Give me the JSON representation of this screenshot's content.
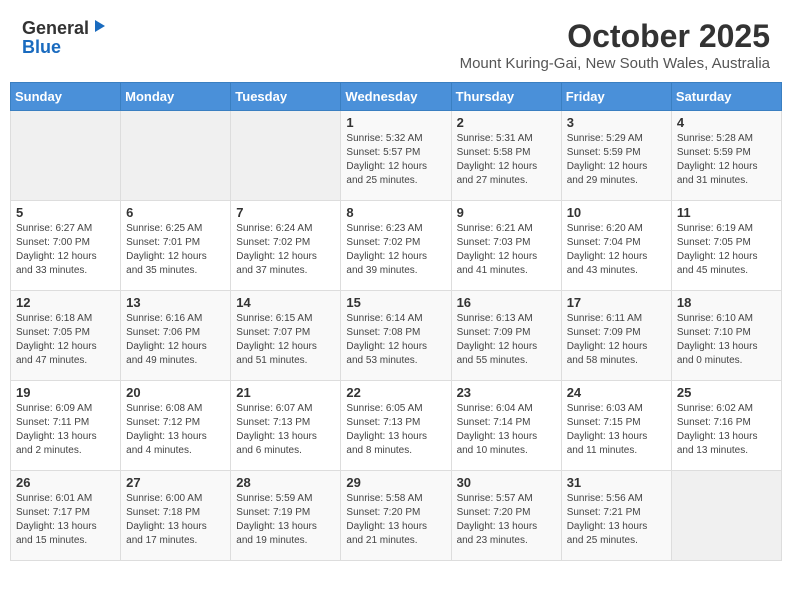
{
  "logo": {
    "general": "General",
    "blue": "Blue"
  },
  "title": "October 2025",
  "location": "Mount Kuring-Gai, New South Wales, Australia",
  "days_header": [
    "Sunday",
    "Monday",
    "Tuesday",
    "Wednesday",
    "Thursday",
    "Friday",
    "Saturday"
  ],
  "weeks": [
    [
      {
        "num": "",
        "info": ""
      },
      {
        "num": "",
        "info": ""
      },
      {
        "num": "",
        "info": ""
      },
      {
        "num": "1",
        "info": "Sunrise: 5:32 AM\nSunset: 5:57 PM\nDaylight: 12 hours\nand 25 minutes."
      },
      {
        "num": "2",
        "info": "Sunrise: 5:31 AM\nSunset: 5:58 PM\nDaylight: 12 hours\nand 27 minutes."
      },
      {
        "num": "3",
        "info": "Sunrise: 5:29 AM\nSunset: 5:59 PM\nDaylight: 12 hours\nand 29 minutes."
      },
      {
        "num": "4",
        "info": "Sunrise: 5:28 AM\nSunset: 5:59 PM\nDaylight: 12 hours\nand 31 minutes."
      }
    ],
    [
      {
        "num": "5",
        "info": "Sunrise: 6:27 AM\nSunset: 7:00 PM\nDaylight: 12 hours\nand 33 minutes."
      },
      {
        "num": "6",
        "info": "Sunrise: 6:25 AM\nSunset: 7:01 PM\nDaylight: 12 hours\nand 35 minutes."
      },
      {
        "num": "7",
        "info": "Sunrise: 6:24 AM\nSunset: 7:02 PM\nDaylight: 12 hours\nand 37 minutes."
      },
      {
        "num": "8",
        "info": "Sunrise: 6:23 AM\nSunset: 7:02 PM\nDaylight: 12 hours\nand 39 minutes."
      },
      {
        "num": "9",
        "info": "Sunrise: 6:21 AM\nSunset: 7:03 PM\nDaylight: 12 hours\nand 41 minutes."
      },
      {
        "num": "10",
        "info": "Sunrise: 6:20 AM\nSunset: 7:04 PM\nDaylight: 12 hours\nand 43 minutes."
      },
      {
        "num": "11",
        "info": "Sunrise: 6:19 AM\nSunset: 7:05 PM\nDaylight: 12 hours\nand 45 minutes."
      }
    ],
    [
      {
        "num": "12",
        "info": "Sunrise: 6:18 AM\nSunset: 7:05 PM\nDaylight: 12 hours\nand 47 minutes."
      },
      {
        "num": "13",
        "info": "Sunrise: 6:16 AM\nSunset: 7:06 PM\nDaylight: 12 hours\nand 49 minutes."
      },
      {
        "num": "14",
        "info": "Sunrise: 6:15 AM\nSunset: 7:07 PM\nDaylight: 12 hours\nand 51 minutes."
      },
      {
        "num": "15",
        "info": "Sunrise: 6:14 AM\nSunset: 7:08 PM\nDaylight: 12 hours\nand 53 minutes."
      },
      {
        "num": "16",
        "info": "Sunrise: 6:13 AM\nSunset: 7:09 PM\nDaylight: 12 hours\nand 55 minutes."
      },
      {
        "num": "17",
        "info": "Sunrise: 6:11 AM\nSunset: 7:09 PM\nDaylight: 12 hours\nand 58 minutes."
      },
      {
        "num": "18",
        "info": "Sunrise: 6:10 AM\nSunset: 7:10 PM\nDaylight: 13 hours\nand 0 minutes."
      }
    ],
    [
      {
        "num": "19",
        "info": "Sunrise: 6:09 AM\nSunset: 7:11 PM\nDaylight: 13 hours\nand 2 minutes."
      },
      {
        "num": "20",
        "info": "Sunrise: 6:08 AM\nSunset: 7:12 PM\nDaylight: 13 hours\nand 4 minutes."
      },
      {
        "num": "21",
        "info": "Sunrise: 6:07 AM\nSunset: 7:13 PM\nDaylight: 13 hours\nand 6 minutes."
      },
      {
        "num": "22",
        "info": "Sunrise: 6:05 AM\nSunset: 7:13 PM\nDaylight: 13 hours\nand 8 minutes."
      },
      {
        "num": "23",
        "info": "Sunrise: 6:04 AM\nSunset: 7:14 PM\nDaylight: 13 hours\nand 10 minutes."
      },
      {
        "num": "24",
        "info": "Sunrise: 6:03 AM\nSunset: 7:15 PM\nDaylight: 13 hours\nand 11 minutes."
      },
      {
        "num": "25",
        "info": "Sunrise: 6:02 AM\nSunset: 7:16 PM\nDaylight: 13 hours\nand 13 minutes."
      }
    ],
    [
      {
        "num": "26",
        "info": "Sunrise: 6:01 AM\nSunset: 7:17 PM\nDaylight: 13 hours\nand 15 minutes."
      },
      {
        "num": "27",
        "info": "Sunrise: 6:00 AM\nSunset: 7:18 PM\nDaylight: 13 hours\nand 17 minutes."
      },
      {
        "num": "28",
        "info": "Sunrise: 5:59 AM\nSunset: 7:19 PM\nDaylight: 13 hours\nand 19 minutes."
      },
      {
        "num": "29",
        "info": "Sunrise: 5:58 AM\nSunset: 7:20 PM\nDaylight: 13 hours\nand 21 minutes."
      },
      {
        "num": "30",
        "info": "Sunrise: 5:57 AM\nSunset: 7:20 PM\nDaylight: 13 hours\nand 23 minutes."
      },
      {
        "num": "31",
        "info": "Sunrise: 5:56 AM\nSunset: 7:21 PM\nDaylight: 13 hours\nand 25 minutes."
      },
      {
        "num": "",
        "info": ""
      }
    ]
  ]
}
